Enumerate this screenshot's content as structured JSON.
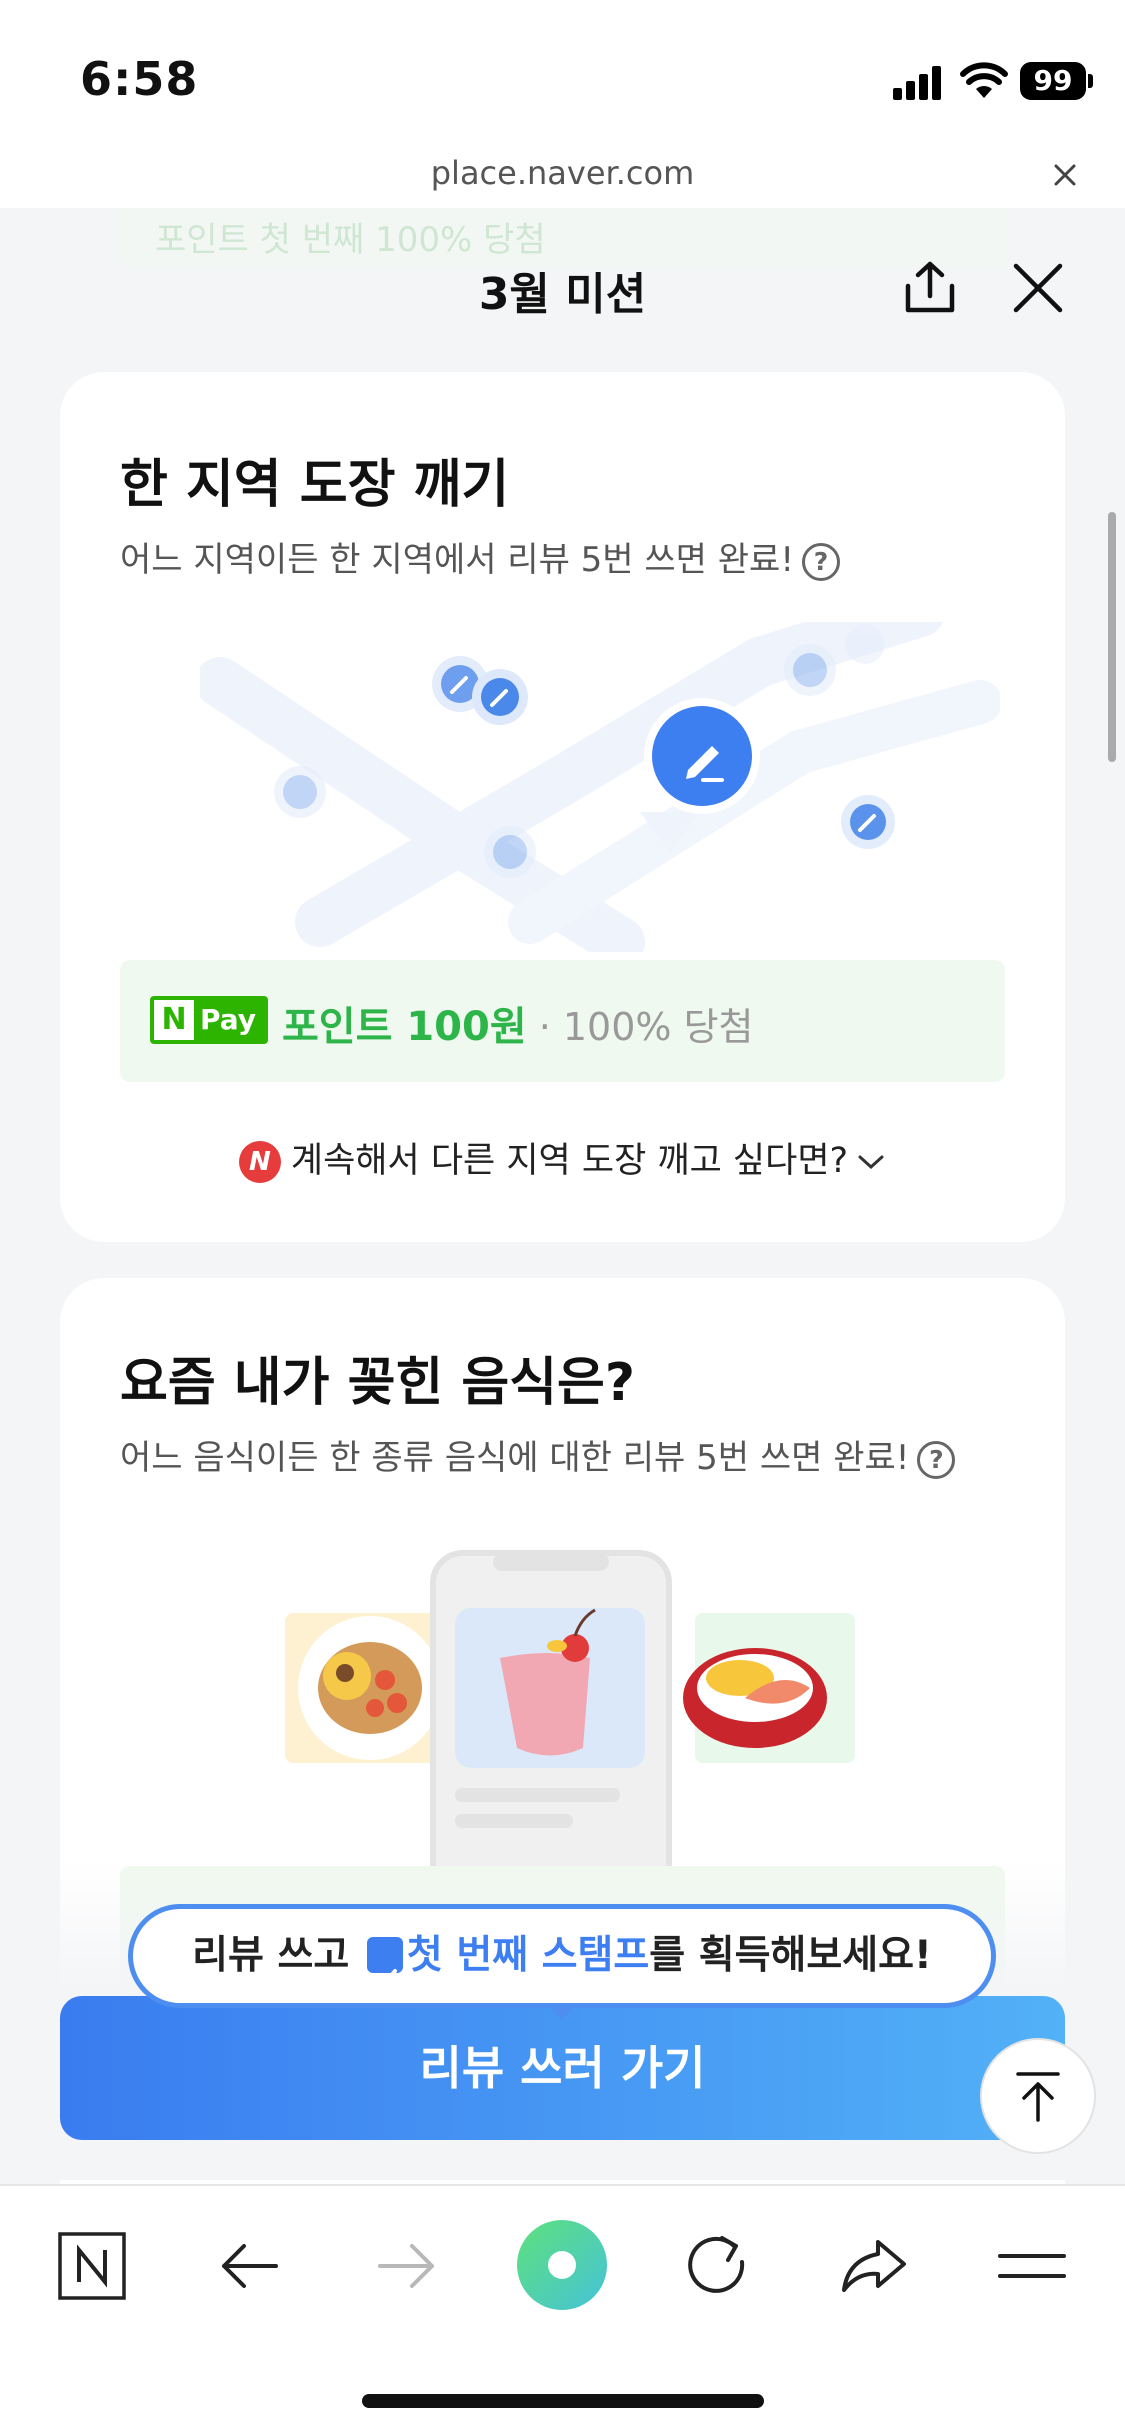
{
  "status_bar": {
    "time": "6:58",
    "battery": "99"
  },
  "browser": {
    "url": "place.naver.com"
  },
  "header": {
    "title": "3월 미션",
    "ghost_text": "포인트 첫 번째 100% 당첨"
  },
  "missions": [
    {
      "title": "한 지역 도장 깨기",
      "description": "어느 지역이든 한 지역에서 리뷰 5번 쓰면 완료!",
      "help": "?",
      "reward": {
        "badge_n": "N",
        "badge_pay": "Pay",
        "label": "포인트 100원",
        "separator": " · ",
        "note": "100% 당첨"
      },
      "continue_text": "계속해서 다른 지역 도장 깨고 싶다면?",
      "naver_icon": "N"
    },
    {
      "title": "요즘 내가 꽂힌 음식은?",
      "description": "어느 음식이든 한 종류 음식에 대한 리뷰 5번 쓰면 완료!",
      "help": "?"
    }
  ],
  "tooltip": {
    "prefix": "리뷰 쓰고 ",
    "highlight": "첫 번째 스탬프",
    "suffix": "를 획득해보세요!"
  },
  "cta": {
    "label": "리뷰 쓰러 가기"
  },
  "toolbar": {
    "items": [
      "naver-home-icon",
      "back-arrow-icon",
      "forward-arrow-icon",
      "green-dot-icon",
      "refresh-icon",
      "share-arrow-icon",
      "menu-icon"
    ]
  },
  "colors": {
    "primary_blue": "#3a7cf0",
    "naver_green": "#2db400",
    "reward_green": "#2db54a",
    "naver_red": "#e63c3c"
  }
}
